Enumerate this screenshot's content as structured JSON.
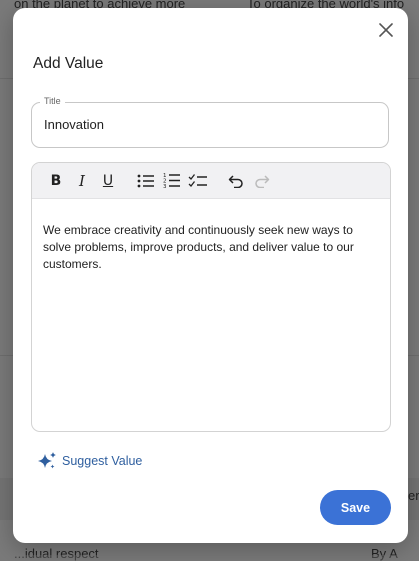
{
  "background": {
    "top_left_text": "on the planet to achieve more",
    "top_right_text": "To organize the world's info",
    "bottom_left_text": "...idual respect",
    "bottom_right_text": "By A",
    "right_edge_text": "er"
  },
  "modal": {
    "title": "Add Value",
    "title_field": {
      "label": "Title",
      "value": "Innovation"
    },
    "editor": {
      "content": "We embrace creativity and continuously seek new ways to solve problems, improve products, and deliver value to our customers.",
      "toolbar": {
        "bold": "B",
        "italic": "I",
        "underline": "U"
      }
    },
    "suggest_label": "Suggest Value",
    "save_label": "Save"
  },
  "colors": {
    "accent": "#3b72d6",
    "link": "#2f5f9f"
  },
  "icons": [
    "close-icon",
    "bullet-list-icon",
    "numbered-list-icon",
    "checklist-icon",
    "undo-icon",
    "redo-icon",
    "sparkle-icon"
  ]
}
